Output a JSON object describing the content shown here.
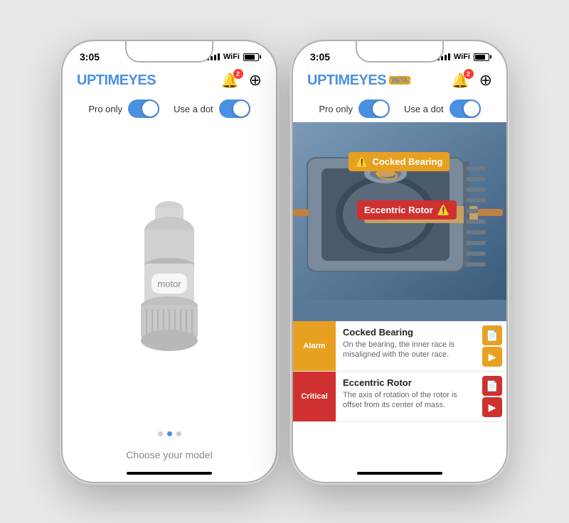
{
  "phones": {
    "phone1": {
      "statusBar": {
        "time": "3:05"
      },
      "header": {
        "logoFirst": "UPTIM",
        "logoSecond": "EYES",
        "notificationCount": "2"
      },
      "toggles": [
        {
          "label": "Pro only",
          "state": "on"
        },
        {
          "label": "Use a dot",
          "state": "on"
        }
      ],
      "motorLabel": "motor",
      "dots": [
        0,
        1,
        2
      ],
      "activeDot": 1,
      "chooseModel": "Choose your model"
    },
    "phone2": {
      "statusBar": {
        "time": "3:05"
      },
      "header": {
        "logoFirst": "UPTIM",
        "logoSecond": "EYES",
        "betaBadge": "BETA",
        "notificationCount": "2"
      },
      "toggles": [
        {
          "label": "Pro only",
          "state": "on"
        },
        {
          "label": "Use a dot",
          "state": "on"
        }
      ],
      "annotations": [
        {
          "type": "alarm",
          "text": "Cocked Bearing",
          "icon": "⚠️"
        },
        {
          "type": "critical",
          "text": "Eccentric Rotor",
          "icon": "⚠️"
        }
      ],
      "diagnosisList": [
        {
          "severity": "Alarm",
          "type": "alarm",
          "title": "Cocked Bearing",
          "description": "On the bearing, the inner race is misaligned with the outer race."
        },
        {
          "severity": "Critical",
          "type": "critical",
          "title": "Eccentric Rotor",
          "description": "The axis of rotation of the rotor is offset from its center of mass."
        }
      ],
      "actionIcons": {
        "pdf": "📄",
        "play": "▶"
      }
    }
  }
}
